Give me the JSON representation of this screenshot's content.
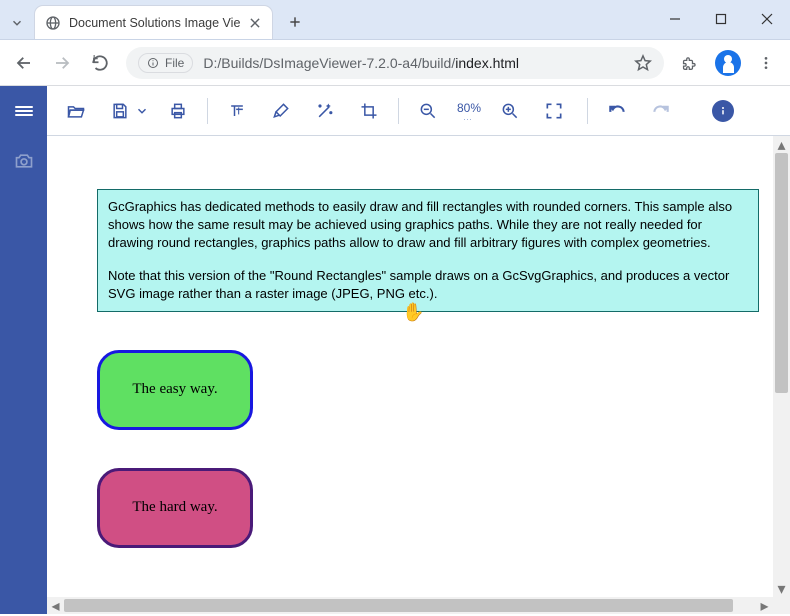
{
  "browser": {
    "tab_title": "Document Solutions Image Vie",
    "file_chip": "File",
    "url_dim": "D:/Builds/DsImageViewer-7.2.0-a4/build/",
    "url_main": "index.html"
  },
  "toolbar": {
    "zoom_label": "80%"
  },
  "document": {
    "para1": "GcGraphics has dedicated methods to easily draw and fill rectangles with rounded corners. This sample also shows how the same result may be achieved using graphics paths. While they are not really needed for drawing round rectangles, graphics paths allow to draw and fill arbitrary figures with complex geometries.",
    "para2": "Note that this version of the \"Round Rectangles\" sample draws on a GcSvgGraphics, and produces a vector SVG image rather than a raster image (JPEG, PNG etc.).",
    "easy_label": "The easy way.",
    "hard_label": "The hard way."
  }
}
